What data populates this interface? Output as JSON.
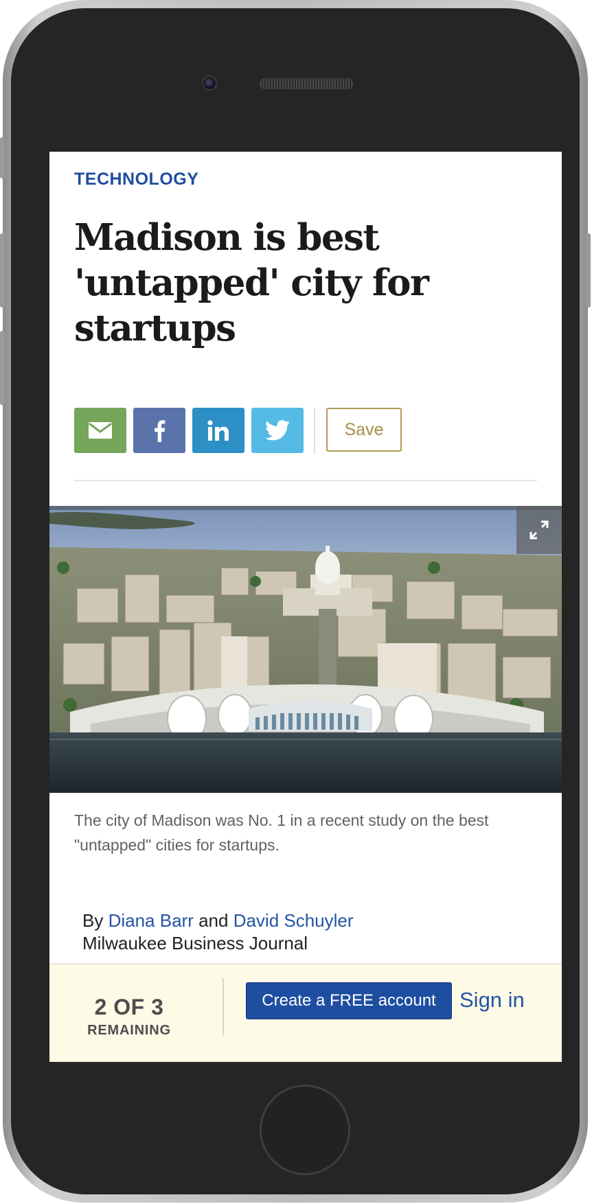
{
  "article": {
    "section": "TECHNOLOGY",
    "headline": "Madison is best 'untapped' city for startups",
    "image_caption": "The city of Madison was No. 1 in a recent study on the best \"untapped\" cities for startups.",
    "byline": {
      "prefix": "By ",
      "author_1": "Diana Barr",
      "joiner": " and ",
      "author_2": "David Schuyler",
      "publication": "Milwaukee Business Journal"
    }
  },
  "share": {
    "save_label": "Save",
    "colors": {
      "email": "#75a65a",
      "facebook": "#5b73ab",
      "linkedin": "#2c8fc6",
      "twitter": "#55bae6"
    },
    "icons": [
      "envelope-icon",
      "facebook-icon",
      "linkedin-icon",
      "twitter-bird-icon"
    ]
  },
  "paywall": {
    "count": "2 OF 3",
    "count_sub": "REMAINING",
    "create_account": "Create a FREE account",
    "sign_in": "Sign in"
  },
  "theme": {
    "accent": "#1e4ea0",
    "save_gold": "#a88d45",
    "paywall_bg": "#fdfae6"
  }
}
